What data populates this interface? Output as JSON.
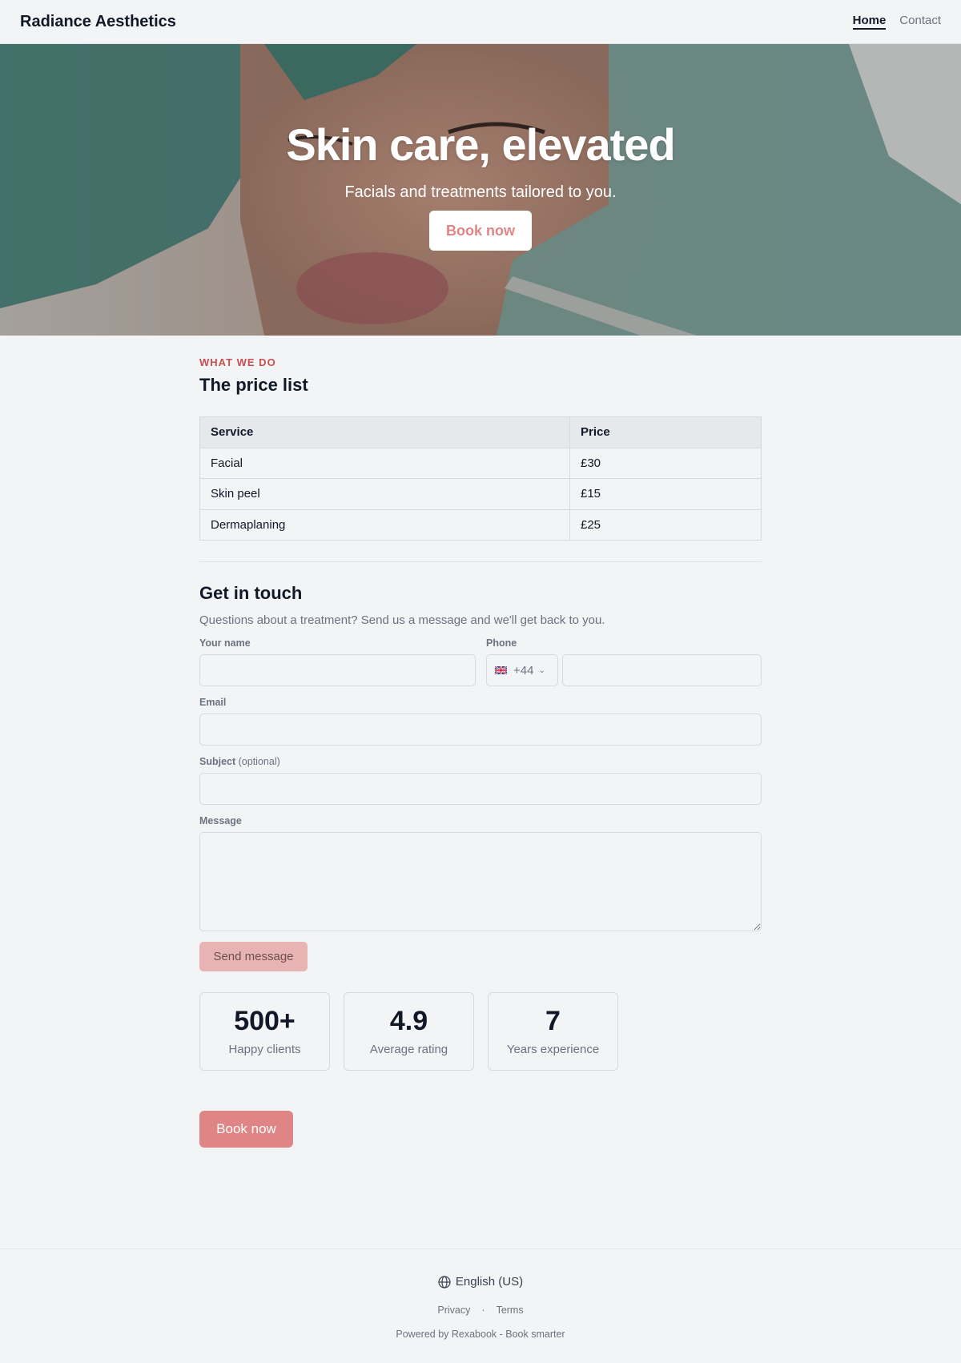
{
  "header": {
    "brand": "Radiance Aesthetics",
    "nav": [
      {
        "label": "Home",
        "active": true
      },
      {
        "label": "Contact",
        "active": false
      }
    ]
  },
  "hero": {
    "title": "Skin care, elevated",
    "subtitle": "Facials and treatments tailored to you.",
    "cta_label": "Book now"
  },
  "prices": {
    "eyebrow": "WHAT WE DO",
    "title": "The price list",
    "columns": [
      "Service",
      "Price"
    ],
    "rows": [
      [
        "Facial",
        "£30"
      ],
      [
        "Skin peel",
        "£15"
      ],
      [
        "Dermaplaning",
        "£25"
      ]
    ]
  },
  "contact": {
    "title": "Get in touch",
    "subtitle": "Questions about a treatment? Send us a message and we'll get back to you.",
    "name_label": "Your name",
    "name_value": "",
    "phone_label": "Phone",
    "phone_country_code": "+44",
    "phone_flag": "uk-flag-icon",
    "phone_value": "",
    "email_label": "Email",
    "email_value": "",
    "subject_label": "Subject",
    "subject_optional": "(optional)",
    "subject_value": "",
    "message_label": "Message",
    "message_value": "",
    "send_label": "Send message"
  },
  "stats": [
    {
      "value": "500+",
      "label": "Happy clients"
    },
    {
      "value": "4.9",
      "label": "Average rating"
    },
    {
      "value": "7",
      "label": "Years experience"
    }
  ],
  "book_label": "Book now",
  "footer": {
    "language": "English (US)",
    "links": [
      "Privacy",
      "Terms"
    ],
    "separator": "·",
    "powered": "Powered by Rexabook - Book smarter"
  },
  "colors": {
    "accent": "#e08585",
    "accent_light": "#e8b3b3",
    "eyebrow": "#c94f4f",
    "background": "#f2f4f6"
  }
}
